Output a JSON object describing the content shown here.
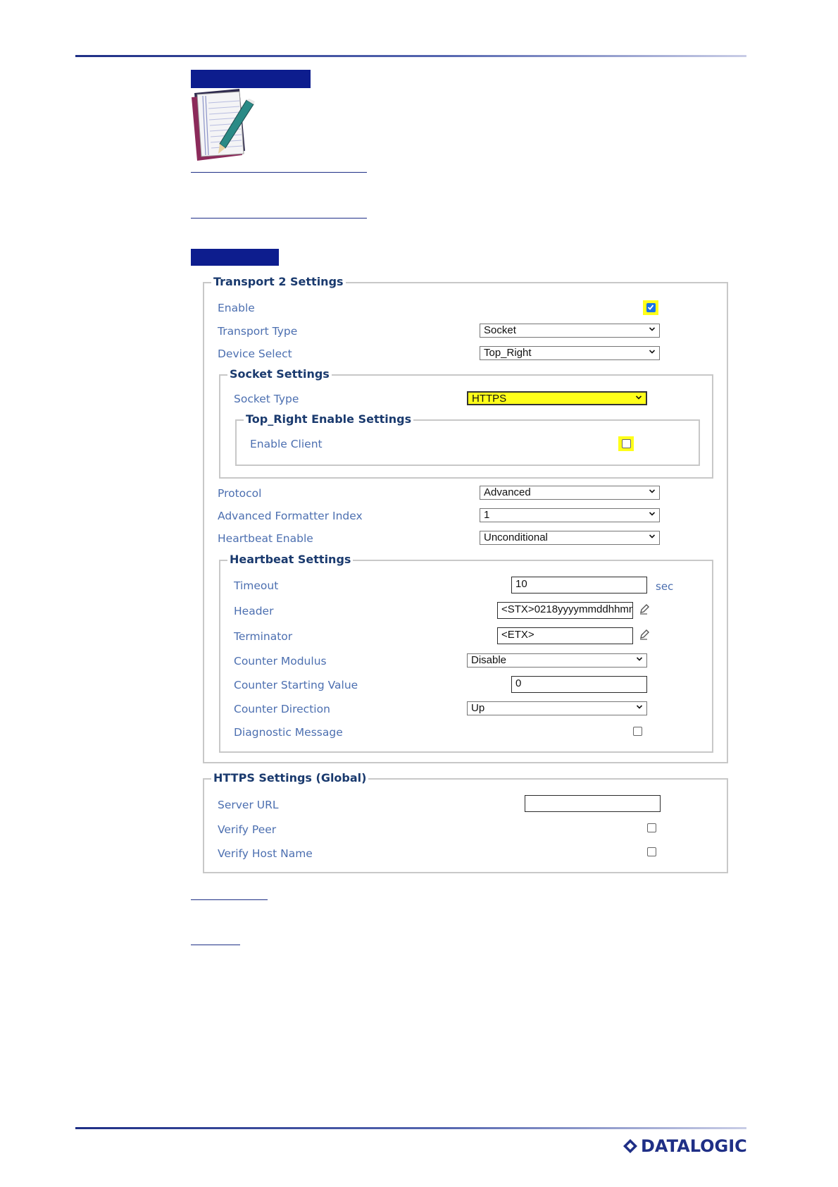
{
  "logo": {
    "text": "DATALOGIC"
  },
  "transport2": {
    "legend": "Transport 2 Settings",
    "enable_label": "Enable",
    "enable_checked": true,
    "transport_type_label": "Transport Type",
    "transport_type_value": "Socket",
    "device_select_label": "Device Select",
    "device_select_value": "Top_Right",
    "socket": {
      "legend": "Socket Settings",
      "socket_type_label": "Socket Type",
      "socket_type_value": "HTTPS",
      "enable_settings": {
        "legend": "Top_Right Enable Settings",
        "enable_client_label": "Enable Client",
        "enable_client_checked": false
      }
    },
    "protocol_label": "Protocol",
    "protocol_value": "Advanced",
    "adv_formatter_label": "Advanced Formatter Index",
    "adv_formatter_value": "1",
    "heartbeat_enable_label": "Heartbeat Enable",
    "heartbeat_enable_value": "Unconditional",
    "heartbeat": {
      "legend": "Heartbeat Settings",
      "timeout_label": "Timeout",
      "timeout_value": "10",
      "timeout_unit": "sec",
      "header_label": "Header",
      "header_value": "<STX>0218yyyymmddhhmm",
      "terminator_label": "Terminator",
      "terminator_value": "<ETX>",
      "counter_modulus_label": "Counter Modulus",
      "counter_modulus_value": "Disable",
      "counter_start_label": "Counter Starting Value",
      "counter_start_value": "0",
      "counter_direction_label": "Counter Direction",
      "counter_direction_value": "Up",
      "diagnostic_label": "Diagnostic Message",
      "diagnostic_checked": false
    }
  },
  "https": {
    "legend": "HTTPS Settings (Global)",
    "server_url_label": "Server URL",
    "server_url_value": "",
    "verify_peer_label": "Verify Peer",
    "verify_peer_checked": false,
    "verify_host_label": "Verify Host Name",
    "verify_host_checked": false
  },
  "colors": {
    "brand": "#1f2f86",
    "highlight": "#ffff1a",
    "label": "#4c6fb0",
    "legend": "#1a3a6e"
  }
}
